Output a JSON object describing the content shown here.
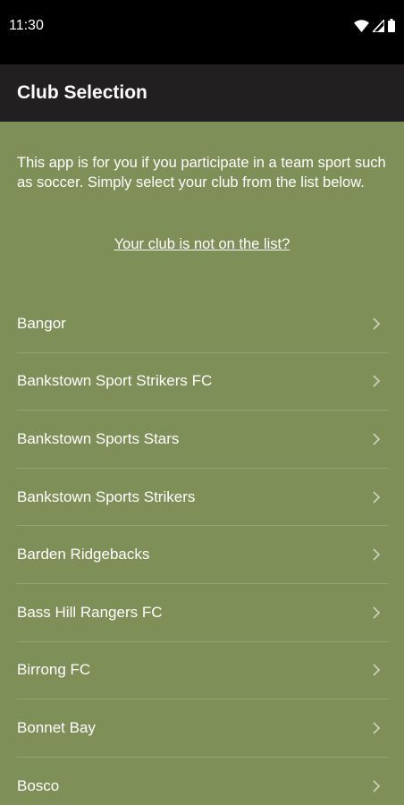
{
  "status_bar": {
    "time": "11:30",
    "icons": [
      "wifi-icon",
      "signal-icon",
      "battery-icon"
    ]
  },
  "app_bar": {
    "title": "Club Selection"
  },
  "intro": {
    "text": "This app is for you if you participate in a team sport such as soccer. Simply select your club from the list below.",
    "link_text": "Your club is not on the list?"
  },
  "clubs": [
    {
      "name": "Bangor"
    },
    {
      "name": "Bankstown Sport Strikers FC"
    },
    {
      "name": "Bankstown Sports Stars"
    },
    {
      "name": "Bankstown Sports Strikers"
    },
    {
      "name": "Barden Ridgebacks"
    },
    {
      "name": "Bass Hill Rangers FC"
    },
    {
      "name": "Birrong FC"
    },
    {
      "name": "Bonnet Bay"
    },
    {
      "name": "Bosco"
    }
  ],
  "colors": {
    "background": "#7f8f58",
    "app_bar": "#221f20",
    "status_bar": "#000000",
    "chevron": "#c9cfb9"
  }
}
